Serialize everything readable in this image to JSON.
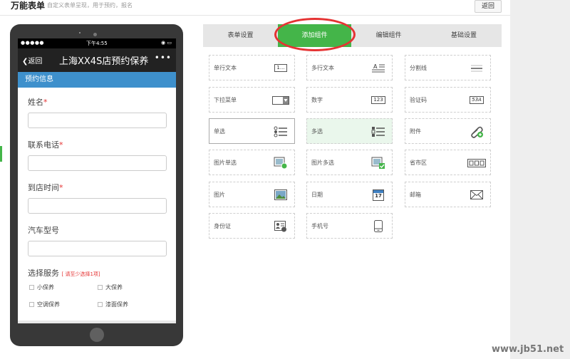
{
  "header": {
    "title": "万能表单",
    "subtitle": "自定义表单呈现，用于预约，报名",
    "back_button": "返回"
  },
  "phone": {
    "status": {
      "signal": "●●●●●",
      "time": "下午4:55",
      "icons": "◉ ▭"
    },
    "nav": {
      "back": "返回",
      "title": "上海XX4S店预约保养",
      "more": "•••"
    },
    "section": "预约信息",
    "fields": [
      {
        "label": "姓名",
        "required": "*"
      },
      {
        "label": "联系电话",
        "required": "*"
      },
      {
        "label": "到店时间",
        "required": "*"
      },
      {
        "label": "汽车型号",
        "required": ""
      }
    ],
    "service": {
      "label": "选择服务",
      "hint": "[ 请至少选择1项]",
      "options": [
        "小保养",
        "大保养",
        "空调保养",
        "漆面保养"
      ]
    }
  },
  "tabs": [
    {
      "label": "表单设置"
    },
    {
      "label": "添加组件"
    },
    {
      "label": "编辑组件"
    },
    {
      "label": "基础设置"
    }
  ],
  "components": [
    {
      "label": "单行文本",
      "icon": "single-line-text-icon",
      "icon_text": "1..."
    },
    {
      "label": "多行文本",
      "icon": "multi-line-text-icon"
    },
    {
      "label": "分割线",
      "icon": "divider-icon"
    },
    {
      "label": "下拉菜单",
      "icon": "dropdown-icon"
    },
    {
      "label": "数字",
      "icon": "number-icon",
      "icon_text": "123"
    },
    {
      "label": "验证码",
      "icon": "captcha-icon",
      "icon_text": "53A"
    },
    {
      "label": "单选",
      "icon": "single-choice-icon"
    },
    {
      "label": "多选",
      "icon": "multi-choice-icon"
    },
    {
      "label": "附件",
      "icon": "attachment-icon"
    },
    {
      "label": "图片单选",
      "icon": "image-single-icon"
    },
    {
      "label": "图片多选",
      "icon": "image-multi-icon"
    },
    {
      "label": "省市区",
      "icon": "region-icon"
    },
    {
      "label": "图片",
      "icon": "image-icon"
    },
    {
      "label": "日期",
      "icon": "date-icon",
      "icon_text": "17"
    },
    {
      "label": "邮箱",
      "icon": "email-icon"
    },
    {
      "label": "身份证",
      "icon": "id-card-icon"
    },
    {
      "label": "手机号",
      "icon": "mobile-icon"
    }
  ],
  "colors": {
    "accent": "#44b549",
    "highlight_ring": "#e53333",
    "section_bar": "#3e90cc"
  },
  "watermark": "www.jb51.net"
}
